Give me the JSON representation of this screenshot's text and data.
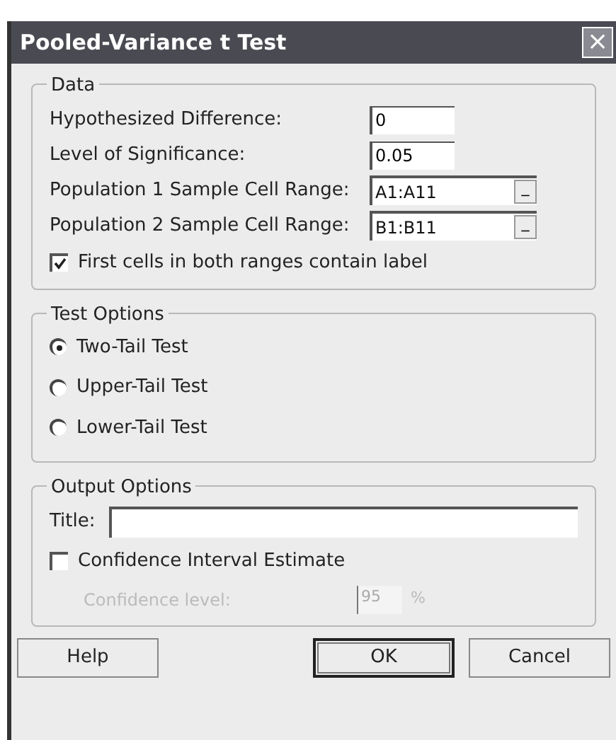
{
  "window": {
    "title": "Pooled-Variance t Test",
    "close": "×"
  },
  "data_group": {
    "legend": "Data",
    "fields": [
      {
        "kind": "text",
        "label": "Hypothesized Difference:",
        "value": "0"
      },
      {
        "kind": "text",
        "label": "Level of Significance:",
        "value": "0.05"
      },
      {
        "kind": "range",
        "label": "Population 1 Sample Cell Range:",
        "value": "A1:A11",
        "button": "_"
      },
      {
        "kind": "range",
        "label": "Population 2 Sample Cell Range:",
        "value": "B1:B11",
        "button": "_"
      }
    ],
    "labels_checkbox": {
      "label": "First cells in both ranges contain label",
      "checked": true
    }
  },
  "test_options": {
    "legend": "Test Options",
    "options": [
      {
        "label": "Two-Tail Test",
        "selected": true
      },
      {
        "label": "Upper-Tail Test",
        "selected": false
      },
      {
        "label": "Lower-Tail Test",
        "selected": false
      }
    ]
  },
  "output_options": {
    "legend": "Output Options",
    "title_label": "Title:",
    "ci_checkbox": {
      "label": "Confidence Interval Estimate",
      "checked": false
    },
    "confidence": {
      "label": "Confidence level:",
      "value": "95",
      "unit": "%",
      "disabled": true
    }
  },
  "buttons": [
    {
      "label": "Help",
      "default": false
    },
    {
      "label": "OK",
      "default": true
    },
    {
      "label": "Cancel",
      "default": false
    }
  ]
}
